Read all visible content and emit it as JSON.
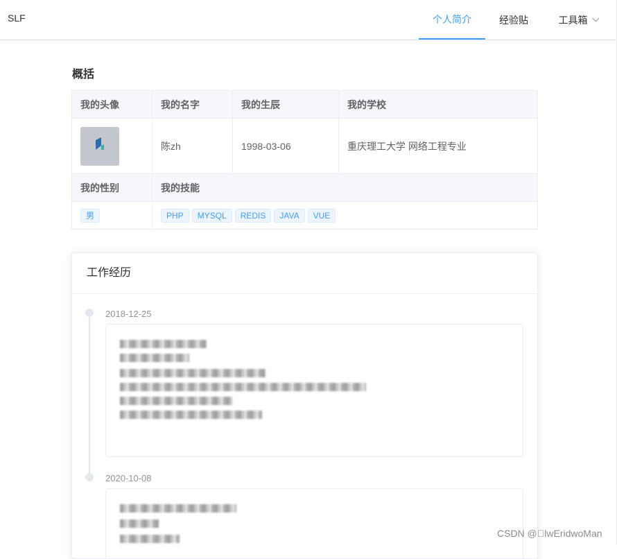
{
  "header": {
    "logo": "SLF",
    "nav": [
      {
        "label": "个人简介",
        "active": true
      },
      {
        "label": "经验贴",
        "active": false
      },
      {
        "label": "工具箱",
        "active": false
      }
    ]
  },
  "overview": {
    "title": "概括",
    "labels": {
      "avatar": "我的头像",
      "name": "我的名字",
      "birthday": "我的生辰",
      "school": "我的学校",
      "gender": "我的性别",
      "skills": "我的技能"
    },
    "values": {
      "name": "陈zh",
      "birthday": "1998-03-06",
      "school": "重庆理工大学 网络工程专业",
      "gender": "男"
    },
    "skills": [
      "PHP",
      "MYSQL",
      "REDIS",
      "JAVA",
      "VUE"
    ]
  },
  "experience": {
    "title": "工作经历",
    "entries": [
      {
        "date": "2018-12-25"
      },
      {
        "date": "2020-10-08"
      }
    ]
  },
  "watermark": "CSDN @\u0000lwEridwoMan",
  "colors": {
    "accent": "#409eff",
    "tag_bg": "#ecf5ff",
    "label_bg": "#f5f7fa"
  }
}
